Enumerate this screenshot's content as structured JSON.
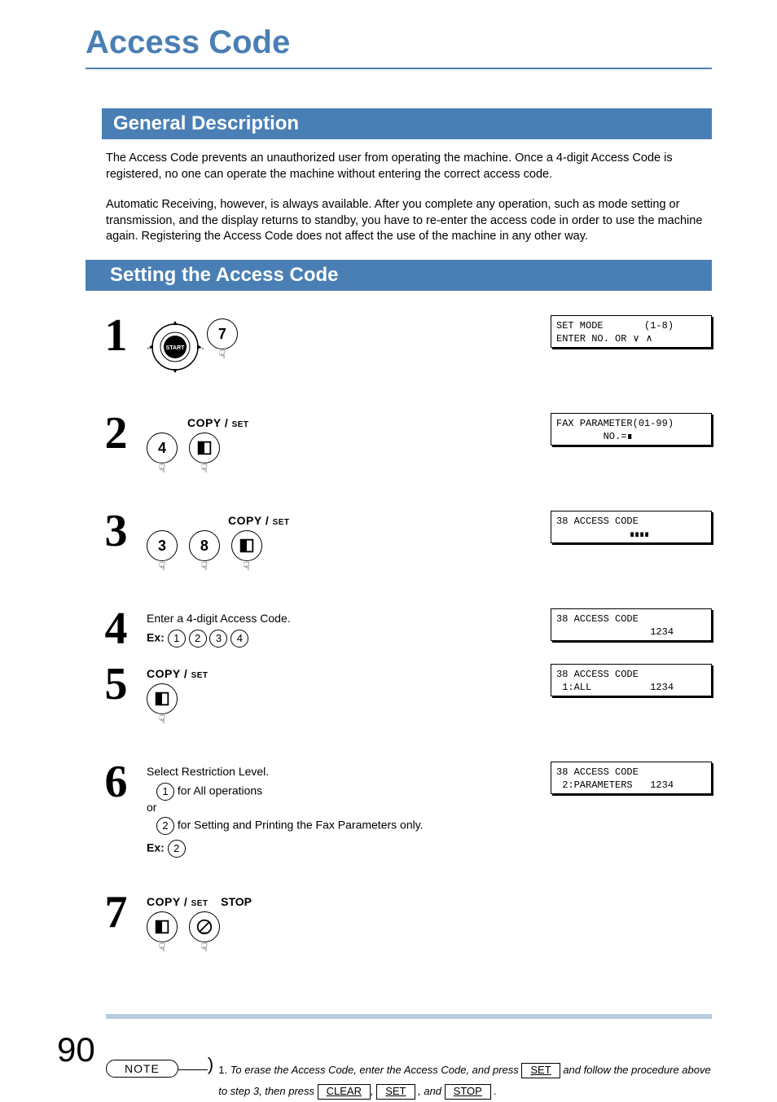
{
  "title": "Access Code",
  "sections": {
    "general": {
      "heading": "General Description",
      "para1": "The Access Code prevents an unauthorized user from operating the machine.  Once a 4-digit Access Code is registered, no one can operate the machine without entering the correct access code.",
      "para2": "Automatic Receiving, however, is always available.  After you complete any operation, such as mode setting or transmission, and the display returns to standby, you have to re-enter the access code in order to use the machine again.  Registering the Access Code does not affect the use of the machine in any other way."
    },
    "setting": {
      "heading": "Setting the Access Code"
    }
  },
  "steps": [
    {
      "num": "1",
      "key": "7",
      "lcd_line1": "SET MODE       (1-8)",
      "lcd_line2": "ENTER NO. OR ∨ ∧"
    },
    {
      "num": "2",
      "label_top": "COPY / SET",
      "keys": [
        "4"
      ],
      "lcd_line1": "FAX PARAMETER(01-99)",
      "lcd_line2": "        NO.=∎"
    },
    {
      "num": "3",
      "label_top": "COPY / SET",
      "keys": [
        "3",
        "8"
      ],
      "lcd_line1": "38 ACCESS CODE",
      "lcd_line2": "                ∎∎∎∎"
    },
    {
      "num": "4",
      "text": "Enter a 4-digit Access Code.",
      "ex_label": "Ex:",
      "ex_keys": [
        "1",
        "2",
        "3",
        "4"
      ],
      "lcd_line1": "38 ACCESS CODE",
      "lcd_line2": "                1234"
    },
    {
      "num": "5",
      "label_top": "COPY / SET",
      "lcd_line1": "38 ACCESS CODE",
      "lcd_line2": " 1:ALL          1234"
    },
    {
      "num": "6",
      "text_a": "Select Restriction Level.",
      "opt1_key": "1",
      "opt1_text": " for All operations",
      "or": "or",
      "opt2_key": "2",
      "opt2_text": " for Setting and Printing the Fax Parameters only.",
      "ex_label": "Ex:",
      "ex_key": "2",
      "lcd_line1": "38 ACCESS CODE",
      "lcd_line2": " 2:PARAMETERS   1234"
    },
    {
      "num": "7",
      "label_copyset": "COPY / SET",
      "label_stop": "STOP"
    }
  ],
  "note": {
    "label": "NOTE",
    "item_num": "1.",
    "text_a": "To erase the Access Code, enter the Access Code, and press ",
    "btn1": "SET",
    "text_b": " and follow the procedure above to step 3, then press ",
    "btn2": "CLEAR",
    "sep1": ", ",
    "btn3": "SET",
    "sep2": " , and ",
    "btn4": "STOP",
    "end": " ."
  },
  "page_number": "90"
}
